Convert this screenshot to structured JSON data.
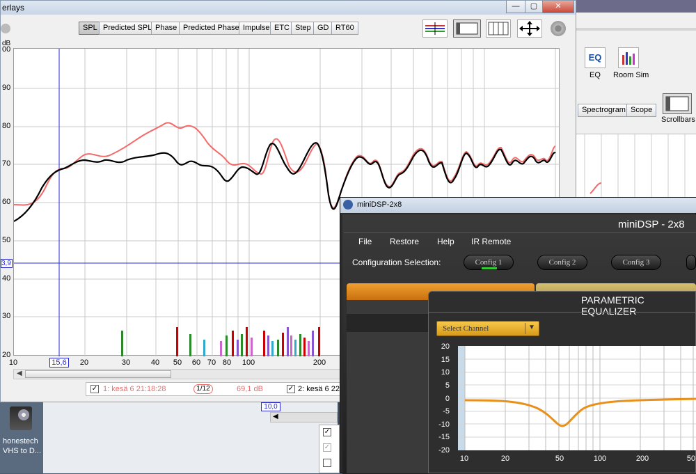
{
  "rew": {
    "title_fragment": "erlays",
    "window_buttons": [
      "—",
      "▢",
      "✕"
    ],
    "tabs": [
      "SPL",
      "Predicted SPL",
      "Phase",
      "Predicted Phase",
      "Impulse",
      "ETC",
      "Step",
      "GD",
      "RT60"
    ],
    "selected_tab": "SPL",
    "y_unit": "dB",
    "y_ticks": [
      "00",
      "90",
      "80",
      "70",
      "60",
      "50",
      "40",
      "30",
      "20"
    ],
    "x_ticks": [
      "10",
      "20",
      "30",
      "40",
      "50",
      "60",
      "70",
      "80",
      "100",
      "200"
    ],
    "cursor_x_readout": "15,6",
    "cursor_y_readout": "3,9",
    "legend": {
      "item1_label": "1: kesä 6 21:18:28",
      "smoothing": "1/12",
      "item1_value": "69,1 dB",
      "item2_label": "2: kesä 6 22:"
    },
    "lower_readout": "10,0",
    "colors": {
      "trace1": "#f26a6a",
      "trace2": "#000000",
      "cursor": "#2b2bd6"
    }
  },
  "right_panel": {
    "eq_label": "EQ",
    "room_sim_label": "Room Sim",
    "tabs": [
      "Spectrogram",
      "Scope"
    ],
    "scrollbars_label": "Scrollbars"
  },
  "desktop": {
    "icon_label_line1": "honestech",
    "icon_label_line2": "VHS to D..."
  },
  "minidsp": {
    "window_title": "miniDSP-2x8",
    "brand_title": "miniDSP - 2x8",
    "menu": [
      "File",
      "Restore",
      "Help",
      "IR Remote"
    ],
    "config_selection_label": "Configuration Selection:",
    "configs": [
      "Config 1",
      "Config 2",
      "Config 3"
    ],
    "peq": {
      "title": "PARAMETRIC EQUALIZER",
      "select_channel": "Select Channel",
      "y_ticks": [
        "20",
        "15",
        "10",
        "5",
        "0",
        "-5",
        "-10",
        "-15",
        "-20"
      ],
      "x_ticks": [
        "10",
        "20",
        "50",
        "100",
        "200",
        "50"
      ],
      "curve_color": "#e8901a"
    }
  }
}
